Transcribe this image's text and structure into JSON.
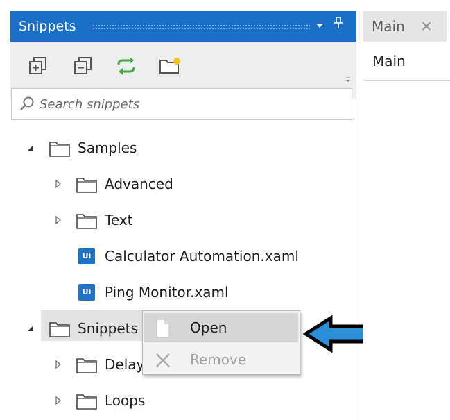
{
  "panel": {
    "title": "Snippets",
    "dropdown_glyph": "▼",
    "pin_glyph": "📌",
    "toolbar": [
      {
        "name": "expand-all",
        "icon": "expand-all-icon"
      },
      {
        "name": "collapse-all",
        "icon": "collapse-all-icon"
      },
      {
        "name": "refresh",
        "icon": "refresh-icon"
      },
      {
        "name": "add-folder",
        "icon": "add-folder-icon"
      }
    ],
    "search": {
      "placeholder": "Search snippets",
      "value": ""
    }
  },
  "tree": {
    "samples": {
      "label": "Samples",
      "expanded": true
    },
    "advanced": {
      "label": "Advanced"
    },
    "text": {
      "label": "Text"
    },
    "calculator": {
      "label": "Calculator Automation.xaml",
      "icon_text": "Ui"
    },
    "ping": {
      "label": "Ping Monitor.xaml",
      "icon_text": "Ui"
    },
    "snippets": {
      "label": "Snippets",
      "expanded": true,
      "selected": true
    },
    "delay": {
      "label": "Delay"
    },
    "loops": {
      "label": "Loops"
    }
  },
  "context_menu": {
    "open": {
      "label": "Open"
    },
    "remove": {
      "label": "Remove",
      "disabled": true
    }
  },
  "document": {
    "tab_label": "Main",
    "tab_close": "✕",
    "title": "Main"
  },
  "colors": {
    "header_blue": "#1c6fc7",
    "arrow_blue": "#2a8fd6",
    "ui_icon_blue": "#1f74c8"
  }
}
